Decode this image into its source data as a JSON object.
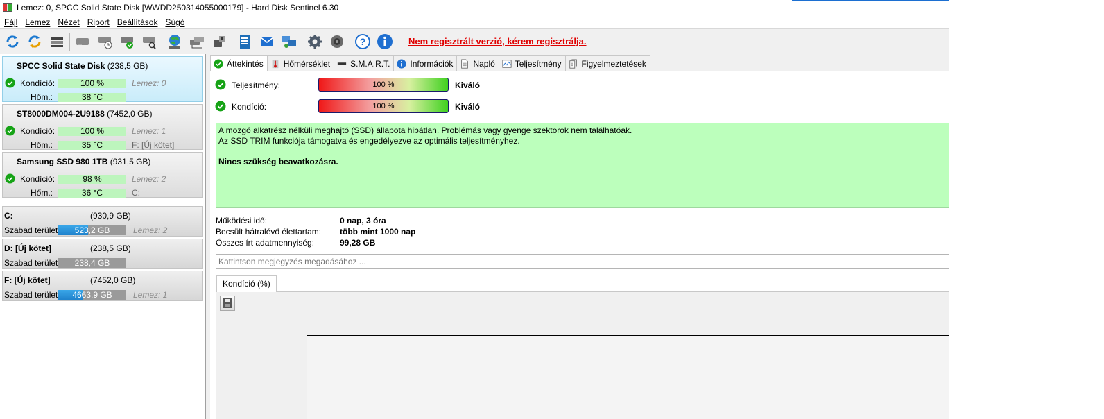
{
  "window": {
    "title": "Lemez: 0, SPCC Solid State Disk [WWDD250314055000179]  -  Hard Disk Sentinel 6.30"
  },
  "menu": {
    "items": [
      "Fájl",
      "Lemez",
      "Nézet",
      "Riport",
      "Beállítások",
      "Súgó"
    ]
  },
  "toolbar": {
    "registration_warning": "Nem regisztrált verzió, kérem regisztrálja.",
    "icons": [
      "refresh-icon",
      "refresh-all-icon",
      "disk-list-icon",
      "disk-icon",
      "disk-schedule-icon",
      "disk-ok-icon",
      "disk-search-icon",
      "globe-icon",
      "network-disk-icon",
      "usb-disk-icon",
      "report-icon",
      "email-icon",
      "network-icon",
      "settings-icon",
      "sound-icon",
      "help-icon",
      "info-icon"
    ]
  },
  "colors": {
    "selected_card": "#c9ecfa",
    "status_green": "#bcffbc",
    "health_bar": "#bdf5bd",
    "warning_red": "#e00000",
    "free_space_blue": "#1f82cc"
  },
  "disks": [
    {
      "name": "SPCC Solid State Disk",
      "size": "(238,5 GB)",
      "condition_label": "Kondíció:",
      "condition": "100 %",
      "temp_label": "Hőm.:",
      "temp": "38 °C",
      "disk_index": "Lemez: 0",
      "volume": "",
      "selected": true
    },
    {
      "name": "ST8000DM004-2U9188",
      "size": "(7452,0 GB)",
      "condition_label": "Kondíció:",
      "condition": "100 %",
      "temp_label": "Hőm.:",
      "temp": "35 °C",
      "disk_index": "Lemez: 1",
      "volume": "F: [Új kötet]",
      "selected": false
    },
    {
      "name": "Samsung SSD 980 1TB",
      "size": "(931,5 GB)",
      "condition_label": "Kondíció:",
      "condition": "98 %",
      "temp_label": "Hőm.:",
      "temp": "36 °C",
      "disk_index": "Lemez: 2",
      "volume": "C:",
      "selected": false
    }
  ],
  "volumes": [
    {
      "name": "C:",
      "size": "(930,9 GB)",
      "free_label": "Szabad terület",
      "free": "523,2 GB",
      "used_fraction": 0.44,
      "disk": "Lemez: 2"
    },
    {
      "name": "D: [Új kötet]",
      "size": "(238,5 GB)",
      "free_label": "Szabad terület",
      "free": "238,4 GB",
      "used_fraction": 0.0,
      "disk": ""
    },
    {
      "name": "F: [Új kötet]",
      "size": "(7452,0 GB)",
      "free_label": "Szabad terület",
      "free": "4663,9 GB",
      "used_fraction": 0.37,
      "disk": "Lemez: 1"
    }
  ],
  "tabs": [
    "Áttekintés",
    "Hőmérséklet",
    "S.M.A.R.T.",
    "Információk",
    "Napló",
    "Teljesítmény",
    "Figyelmeztetések"
  ],
  "overview": {
    "performance_label": "Teljesítmény:",
    "performance_value": "100 %",
    "performance_rating": "Kiváló",
    "health_label": "Kondíció:",
    "health_value": "100 %",
    "health_rating": "Kiváló",
    "status_lines": [
      "A mozgó alkatrész nélküli meghajtó (SSD) állapota hibátlan. Problémás vagy gyenge szektorok nem találhatóak.",
      "Az SSD TRIM funkciója támogatva és engedélyezve az optimális teljesítményhez."
    ],
    "status_action": "Nincs szükség beavatkozásra.",
    "info": [
      {
        "label": "Működési idő:",
        "value": "0 nap, 3 óra"
      },
      {
        "label": "Becsült hátralévő élettartam:",
        "value": "több mint 1000 nap"
      },
      {
        "label": "Összes írt adatmennyiség:",
        "value": "99,28 GB"
      }
    ],
    "note_placeholder": "Kattintson megjegyzés megadásához ...",
    "chart_tab": "Kondíció  (%)"
  }
}
